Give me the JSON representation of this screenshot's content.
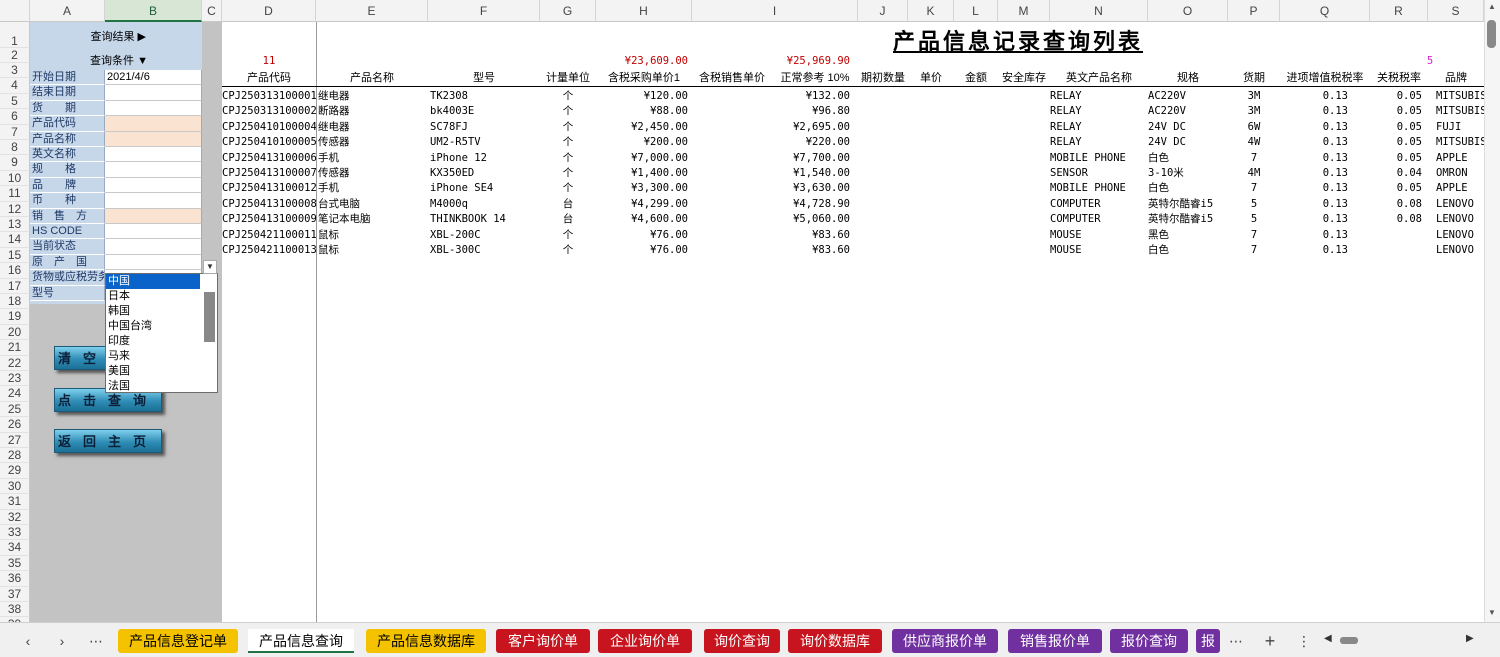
{
  "columns": [
    "A",
    "B",
    "C",
    "D",
    "E",
    "F",
    "G",
    "H",
    "I",
    "J",
    "K",
    "L",
    "M",
    "N",
    "O",
    "P",
    "Q",
    "R",
    "S"
  ],
  "rows": [
    "1",
    "2",
    "3",
    "4",
    "5",
    "6",
    "7",
    "8",
    "9",
    "10",
    "11",
    "12",
    "13",
    "14",
    "15",
    "16",
    "17",
    "18",
    "19",
    "20",
    "21",
    "22",
    "23",
    "24",
    "25",
    "26",
    "27",
    "28",
    "29",
    "30",
    "31",
    "32",
    "33",
    "34",
    "35",
    "36",
    "37",
    "38",
    "39"
  ],
  "panel": {
    "result_toggle": "查询结果 ▶",
    "condition_toggle": "查询条件 ▼",
    "fields": [
      {
        "label": "开始日期",
        "value": "2021/4/6"
      },
      {
        "label": "结束日期",
        "value": ""
      },
      {
        "label": "货　　期",
        "value": ""
      },
      {
        "label": "产品代码",
        "value": ""
      },
      {
        "label": "产品名称",
        "value": ""
      },
      {
        "label": "英文名称",
        "value": ""
      },
      {
        "label": "规　　格",
        "value": ""
      },
      {
        "label": "品　　牌",
        "value": ""
      },
      {
        "label": "币　　种",
        "value": ""
      },
      {
        "label": "销　售　方",
        "value": ""
      },
      {
        "label": "HS CODE",
        "value": ""
      },
      {
        "label": "当前状态",
        "value": ""
      },
      {
        "label": "原　产　国",
        "value": ""
      },
      {
        "label": "货物或应税劳务",
        "value": ""
      },
      {
        "label": "型号",
        "value": ""
      }
    ],
    "buttons": {
      "clear": "清空",
      "query": "点击查询",
      "home": "返回主页"
    }
  },
  "dropdown": {
    "options": [
      "中国",
      "日本",
      "韩国",
      "中国台湾",
      "印度",
      "马来",
      "美国",
      "法国"
    ],
    "selected": "中国"
  },
  "report": {
    "title": "产品信息记录查询列表",
    "count": "11",
    "total_purchase": "¥23,609.00",
    "total_sales": "¥25,969.90",
    "right_number": "5",
    "headers": [
      "产品代码",
      "产品名称",
      "型号",
      "计量单位",
      "含税采购单价1",
      "含税销售单价",
      "正常参考 10%",
      "期初数量",
      "单价",
      "金额",
      "安全库存",
      "英文产品名称",
      "规格",
      "货期",
      "进项增值税税率",
      "关税税率",
      "品牌"
    ],
    "records": [
      [
        "CPJ250313100001",
        "继电器",
        "TK2308",
        "个",
        "¥120.00",
        "¥132.00",
        "RELAY",
        "AC220V",
        "3M",
        "0.13",
        "0.05",
        "MITSUBISHI"
      ],
      [
        "CPJ250313100002",
        "断路器",
        "bk4003E",
        "个",
        "¥88.00",
        "¥96.80",
        "RELAY",
        "AC220V",
        "3M",
        "0.13",
        "0.05",
        "MITSUBISHI"
      ],
      [
        "CPJ250410100004",
        "继电器",
        "SC78FJ",
        "个",
        "¥2,450.00",
        "¥2,695.00",
        "RELAY",
        "24V DC",
        "6W",
        "0.13",
        "0.05",
        "FUJI"
      ],
      [
        "CPJ250410100005",
        "传感器",
        "UM2-R5TV",
        "个",
        "¥200.00",
        "¥220.00",
        "RELAY",
        "24V DC",
        "4W",
        "0.13",
        "0.05",
        "MITSUBISHI"
      ],
      [
        "CPJ250413100006",
        "手机",
        "iPhone 12",
        "个",
        "¥7,000.00",
        "¥7,700.00",
        "MOBILE PHONE",
        "白色",
        "7",
        "0.13",
        "0.05",
        "APPLE"
      ],
      [
        "CPJ250413100007",
        "传感器",
        "KX350ED",
        "个",
        "¥1,400.00",
        "¥1,540.00",
        "SENSOR",
        "3-10米",
        "4M",
        "0.13",
        "0.04",
        "OMRON"
      ],
      [
        "CPJ250413100012",
        "手机",
        "iPhone SE4",
        "个",
        "¥3,300.00",
        "¥3,630.00",
        "MOBILE PHONE",
        "白色",
        "7",
        "0.13",
        "0.05",
        "APPLE"
      ],
      [
        "CPJ250413100008",
        "台式电脑",
        "M4000q",
        "台",
        "¥4,299.00",
        "¥4,728.90",
        "COMPUTER",
        "英特尔酷睿i5",
        "5",
        "0.13",
        "0.08",
        "LENOVO"
      ],
      [
        "CPJ250413100009",
        "笔记本电脑",
        "THINKBOOK 14",
        "台",
        "¥4,600.00",
        "¥5,060.00",
        "COMPUTER",
        "英特尔酷睿i5",
        "5",
        "0.13",
        "0.08",
        "LENOVO"
      ],
      [
        "CPJ250421100011",
        "鼠标",
        "XBL-200C",
        "个",
        "¥76.00",
        "¥83.60",
        "MOUSE",
        "黑色",
        "7",
        "0.13",
        "",
        "LENOVO"
      ],
      [
        "CPJ250421100013",
        "鼠标",
        "XBL-300C",
        "个",
        "¥76.00",
        "¥83.60",
        "MOUSE",
        "白色",
        "7",
        "0.13",
        "",
        "LENOVO"
      ]
    ]
  },
  "tabs": [
    {
      "label": "产品信息登记单",
      "color": "#f5c200",
      "text": "#000"
    },
    {
      "label": "产品信息查询",
      "color": "#ffffff",
      "text": "#000"
    },
    {
      "label": "产品信息数据库",
      "color": "#f5c200",
      "text": "#000"
    },
    {
      "label": "客户询价单",
      "color": "#c8141e",
      "text": "#fff"
    },
    {
      "label": "企业询价单",
      "color": "#c8141e",
      "text": "#fff"
    },
    {
      "label": "询价查询",
      "color": "#c8141e",
      "text": "#fff"
    },
    {
      "label": "询价数据库",
      "color": "#c8141e",
      "text": "#fff"
    },
    {
      "label": "供应商报价单",
      "color": "#7030a0",
      "text": "#fff"
    },
    {
      "label": "销售报价单",
      "color": "#7030a0",
      "text": "#fff"
    },
    {
      "label": "报价查询",
      "color": "#7030a0",
      "text": "#fff"
    },
    {
      "label": "报",
      "color": "#7030a0",
      "text": "#fff"
    }
  ],
  "tab_nav": {
    "prev": "‹",
    "next": "›",
    "more": "⋯",
    "add": "+",
    "menu": "⋮"
  },
  "colors": {
    "label_blue": "#c6d7ea",
    "panel_gray": "#c3c3c3",
    "red_value": "#c00000",
    "magenta_value": "#d41fd4"
  }
}
